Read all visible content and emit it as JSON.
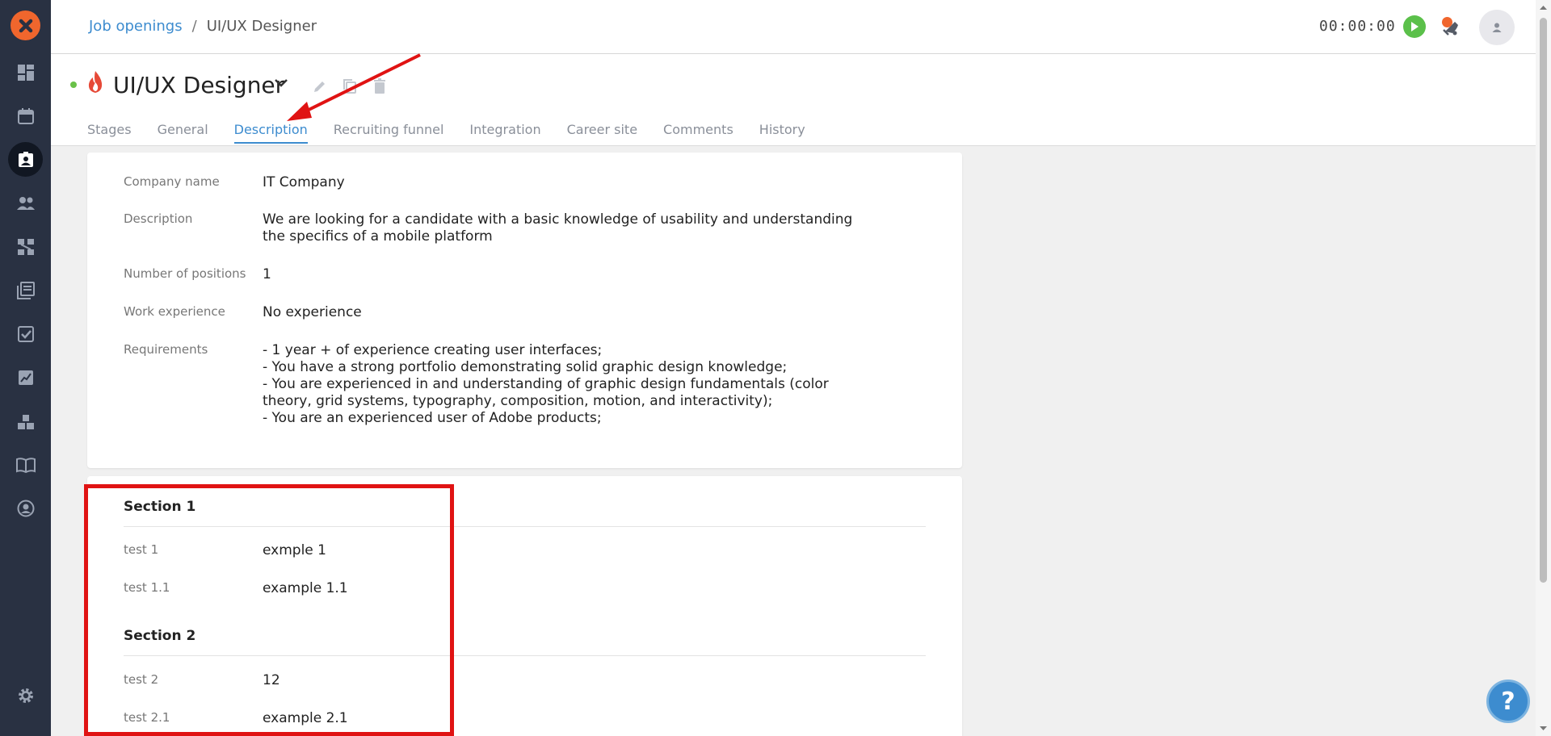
{
  "breadcrumb": {
    "parent": "Job openings",
    "separator": "/",
    "current": "UI/UX Designer"
  },
  "header": {
    "timer": "00:00:00"
  },
  "job": {
    "title": "UI/UX Designer",
    "status_color": "#69c148"
  },
  "tabs": [
    {
      "label": "Stages",
      "active": false
    },
    {
      "label": "General",
      "active": false
    },
    {
      "label": "Description",
      "active": true
    },
    {
      "label": "Recruiting funnel",
      "active": false
    },
    {
      "label": "Integration",
      "active": false
    },
    {
      "label": "Career site",
      "active": false
    },
    {
      "label": "Comments",
      "active": false
    },
    {
      "label": "History",
      "active": false
    }
  ],
  "details": {
    "company_name": {
      "label": "Company name",
      "value": "IT Company"
    },
    "description": {
      "label": "Description",
      "value": "We are looking for a candidate with a basic knowledge of usability and understanding the specifics of a mobile platform"
    },
    "positions": {
      "label": "Number of positions",
      "value": "1"
    },
    "experience": {
      "label": "Work experience",
      "value": "No experience"
    },
    "requirements": {
      "label": "Requirements",
      "value": "- 1 year + of experience creating user interfaces;\n- You have a strong portfolio demonstrating solid graphic design knowledge;\n- You are experienced in and understanding of graphic design fundamentals (color theory, grid systems, typography, composition, motion, and interactivity);\n- You are an experienced user of Adobe products;"
    }
  },
  "sections": [
    {
      "title": "Section 1",
      "fields": [
        {
          "label": "test 1",
          "value": "exmple 1"
        },
        {
          "label": "test 1.1",
          "value": "example 1.1"
        }
      ]
    },
    {
      "title": "Section 2",
      "fields": [
        {
          "label": "test 2",
          "value": "12"
        },
        {
          "label": "test 2.1",
          "value": "example 2.1"
        }
      ]
    }
  ],
  "help": {
    "label": "?"
  },
  "colors": {
    "accent": "#3d8ccf",
    "sidebar": "#293142",
    "brand": "#f0662d",
    "annotation": "#e01313"
  },
  "sidebar_icons": [
    "dashboard-icon",
    "calendar-icon",
    "vacancies-icon",
    "candidates-icon",
    "funnel-icon",
    "library-icon",
    "tasks-icon",
    "reports-icon",
    "integrations-icon",
    "knowledge-base-icon",
    "profile-icon",
    "settings-icon"
  ]
}
